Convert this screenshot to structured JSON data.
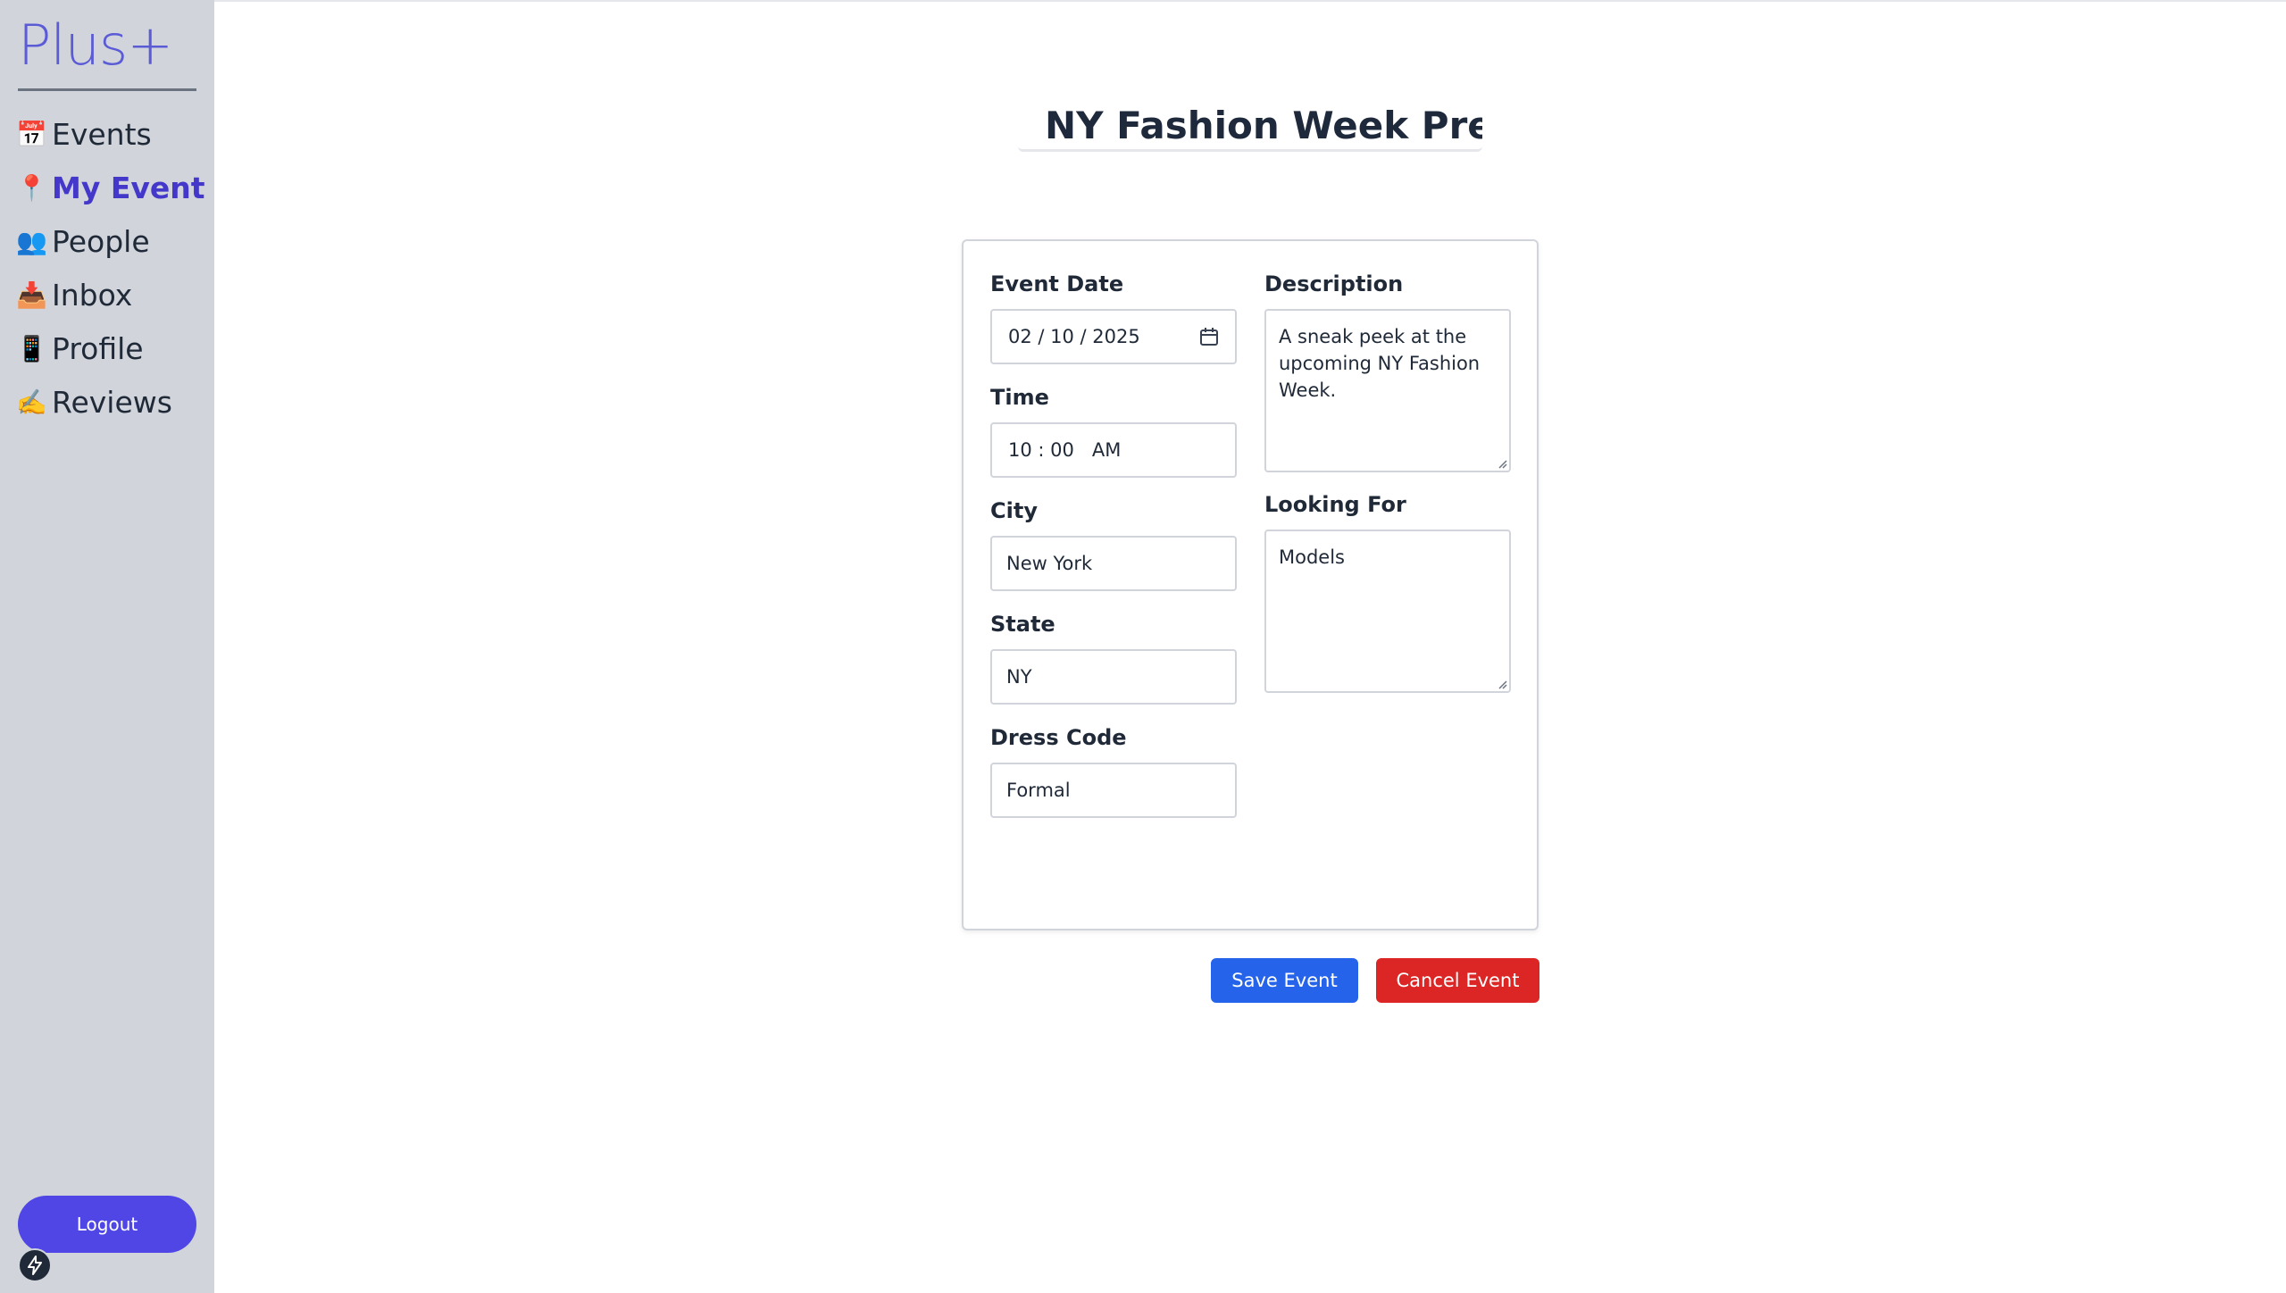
{
  "app": {
    "logo": "Plus+"
  },
  "sidebar": {
    "items": [
      {
        "icon": "📅",
        "label": "Events"
      },
      {
        "icon": "📍",
        "label": "My Event"
      },
      {
        "icon": "👥",
        "label": "People"
      },
      {
        "icon": "📥",
        "label": "Inbox"
      },
      {
        "icon": "📱",
        "label": "Profile"
      },
      {
        "icon": "✍️",
        "label": "Reviews"
      }
    ],
    "active": "My Event",
    "logout_label": "Logout"
  },
  "event": {
    "title": "NY Fashion Week Preview",
    "date_label": "Event Date",
    "date_value": "02 / 10 / 2025",
    "time_label": "Time",
    "time_value": "10 : 00   AM",
    "city_label": "City",
    "city_value": "New York",
    "state_label": "State",
    "state_value": "NY",
    "dress_label": "Dress Code",
    "dress_value": "Formal",
    "description_label": "Description",
    "description_value": "A sneak peek at the upcoming NY Fashion Week.",
    "looking_label": "Looking For",
    "looking_value": "Models"
  },
  "actions": {
    "save_label": "Save Event",
    "cancel_label": "Cancel Event"
  },
  "colors": {
    "sidebar_bg": "#d1d5db",
    "accent": "#4f46e5",
    "save": "#2563eb",
    "cancel": "#dc2626"
  },
  "icons": {
    "calendar": "calendar-icon",
    "bolt": "bolt-icon"
  }
}
